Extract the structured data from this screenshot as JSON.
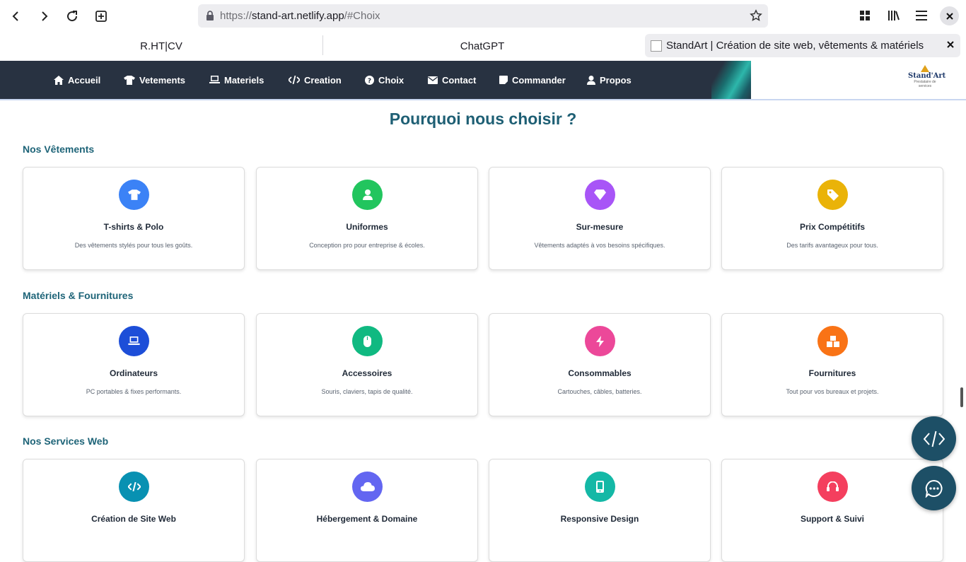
{
  "browser": {
    "url_prefix": "https://",
    "url_host": "stand-art.netlify.app",
    "url_path": "/#Choix",
    "tabs": [
      {
        "label": "R.HT|CV"
      },
      {
        "label": "ChatGPT"
      },
      {
        "label": "StandArt | Création de site web, vêtements & matériels"
      }
    ]
  },
  "nav": {
    "items": [
      {
        "label": "Accueil",
        "icon": "home-icon"
      },
      {
        "label": "Vetements",
        "icon": "shirt-icon"
      },
      {
        "label": "Materiels",
        "icon": "laptop-icon"
      },
      {
        "label": "Creation",
        "icon": "code-icon"
      },
      {
        "label": "Choix",
        "icon": "question-icon"
      },
      {
        "label": "Contact",
        "icon": "envelope-icon"
      },
      {
        "label": "Commander",
        "icon": "note-icon"
      },
      {
        "label": "Propos",
        "icon": "user-icon"
      }
    ],
    "logo_name": "Stand'Art",
    "logo_tagline": "Prestataire de services"
  },
  "page": {
    "title": "Pourquoi nous choisir ?"
  },
  "sections": [
    {
      "title": "Nos Vêtements",
      "cards": [
        {
          "title": "T-shirts & Polo",
          "desc": "Des vêtements stylés pour tous les goûts.",
          "color": "#3b82f6",
          "icon": "tshirt-icon"
        },
        {
          "title": "Uniformes",
          "desc": "Conception pro pour entreprise & écoles.",
          "color": "#22c55e",
          "icon": "user-tie-icon"
        },
        {
          "title": "Sur-mesure",
          "desc": "Vêtements adaptés à vos besoins spécifiques.",
          "color": "#a855f7",
          "icon": "gem-icon"
        },
        {
          "title": "Prix Compétitifs",
          "desc": "Des tarifs avantageux pour tous.",
          "color": "#eab308",
          "icon": "tags-icon"
        }
      ]
    },
    {
      "title": "Matériels & Fournitures",
      "cards": [
        {
          "title": "Ordinateurs",
          "desc": "PC portables & fixes performants.",
          "color": "#1d4ed8",
          "icon": "laptop-icon"
        },
        {
          "title": "Accessoires",
          "desc": "Souris, claviers, tapis de qualité.",
          "color": "#10b981",
          "icon": "mouse-icon"
        },
        {
          "title": "Consommables",
          "desc": "Cartouches, câbles, batteries.",
          "color": "#ec4899",
          "icon": "bolt-icon"
        },
        {
          "title": "Fournitures",
          "desc": "Tout pour vos bureaux et projets.",
          "color": "#f97316",
          "icon": "boxes-icon"
        }
      ]
    },
    {
      "title": "Nos Services Web",
      "cards": [
        {
          "title": "Création de Site Web",
          "desc": "",
          "color": "#0891b2",
          "icon": "code-icon"
        },
        {
          "title": "Hébergement & Domaine",
          "desc": "",
          "color": "#6366f1",
          "icon": "cloud-icon"
        },
        {
          "title": "Responsive Design",
          "desc": "",
          "color": "#14b8a6",
          "icon": "mobile-icon"
        },
        {
          "title": "Support & Suivi",
          "desc": "",
          "color": "#f43f5e",
          "icon": "headset-icon"
        }
      ]
    }
  ],
  "fab": {
    "code_icon": "code-icon",
    "chat_icon": "chat-icon"
  }
}
